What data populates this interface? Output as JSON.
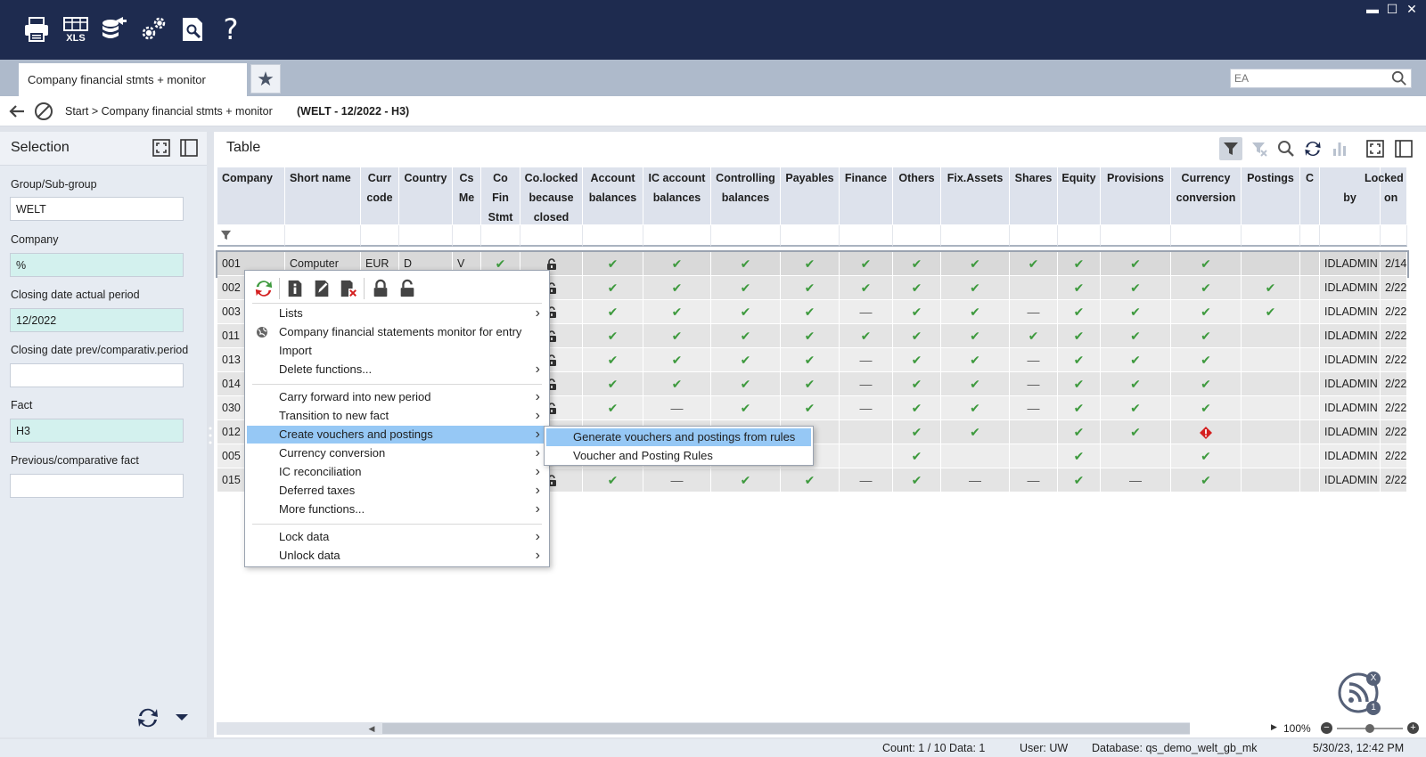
{
  "toolbar": {
    "icons": [
      "printer-icon",
      "xls-export-icon",
      "database-export-icon",
      "settings-icon",
      "document-search-icon",
      "help-icon"
    ],
    "xls_label": "XLS",
    "help_label": "?"
  },
  "window": {
    "minimize": "▬",
    "maximize": "☐",
    "close": "✕"
  },
  "tab": {
    "title": "Company financial stmts + monitor"
  },
  "search": {
    "placeholder": "EA"
  },
  "breadcrumb": {
    "path": "Start > Company financial stmts + monitor",
    "context": "(WELT - 12/2022 - H3)"
  },
  "selection": {
    "title": "Selection",
    "fields": [
      {
        "label": "Group/Sub-group",
        "value": "WELT"
      },
      {
        "label": "Company",
        "value": "%"
      },
      {
        "label": "Closing date actual period",
        "value": "12/2022"
      },
      {
        "label": "Closing date prev/comparativ.period",
        "value": ""
      },
      {
        "label": "Fact",
        "value": "H3"
      },
      {
        "label": "Previous/comparative fact",
        "value": ""
      }
    ]
  },
  "table": {
    "title": "Table",
    "columns": [
      {
        "l1": "Company",
        "l2": "",
        "l3": ""
      },
      {
        "l1": "Short name",
        "l2": "",
        "l3": ""
      },
      {
        "l1": "Curr",
        "l2": "code",
        "l3": ""
      },
      {
        "l1": "Country",
        "l2": "",
        "l3": ""
      },
      {
        "l1": "Cs",
        "l2": "Me",
        "l3": ""
      },
      {
        "l1": "Co",
        "l2": "Fin",
        "l3": "Stmt"
      },
      {
        "l1": "Co.locked",
        "l2": "because",
        "l3": "closed"
      },
      {
        "l1": "Account",
        "l2": "balances",
        "l3": ""
      },
      {
        "l1": "IC account",
        "l2": "balances",
        "l3": ""
      },
      {
        "l1": "Controlling",
        "l2": "balances",
        "l3": ""
      },
      {
        "l1": "Payables",
        "l2": "",
        "l3": ""
      },
      {
        "l1": "Finance",
        "l2": "",
        "l3": ""
      },
      {
        "l1": "Others",
        "l2": "",
        "l3": ""
      },
      {
        "l1": "Fix.Assets",
        "l2": "",
        "l3": ""
      },
      {
        "l1": "Shares",
        "l2": "",
        "l3": ""
      },
      {
        "l1": "Equity",
        "l2": "",
        "l3": ""
      },
      {
        "l1": "Provisions",
        "l2": "",
        "l3": ""
      },
      {
        "l1": "Currency",
        "l2": "conversion",
        "l3": ""
      },
      {
        "l1": "Postings",
        "l2": "",
        "l3": ""
      },
      {
        "l1": "C",
        "l2": "",
        "l3": ""
      },
      {
        "l1": "",
        "l2": "by",
        "l3": ""
      },
      {
        "l1": "Locked",
        "l2": "on",
        "l3": ""
      }
    ],
    "rows": [
      {
        "company": "001",
        "short": "Computer",
        "curr": "EUR",
        "country": "D",
        "csme": "V",
        "cofin": "✔",
        "locked": "lock",
        "cells": [
          "✔",
          "✔",
          "✔",
          "✔",
          "✔",
          "✔",
          "✔",
          "✔",
          "✔",
          "✔",
          "✔",
          ""
        ],
        "by": "IDLADMIN",
        "on": "2/14"
      },
      {
        "company": "002",
        "short": "",
        "curr": "",
        "country": "",
        "csme": "",
        "cofin": "",
        "locked": "lock",
        "cells": [
          "✔",
          "✔",
          "✔",
          "✔",
          "✔",
          "✔",
          "✔",
          "",
          "✔",
          "✔",
          "✔",
          "✔"
        ],
        "by": "IDLADMIN",
        "on": "2/22"
      },
      {
        "company": "003",
        "short": "",
        "curr": "",
        "country": "",
        "csme": "",
        "cofin": "",
        "locked": "lock",
        "cells": [
          "✔",
          "✔",
          "✔",
          "✔",
          "—",
          "✔",
          "✔",
          "—",
          "✔",
          "✔",
          "✔",
          "✔"
        ],
        "by": "IDLADMIN",
        "on": "2/22"
      },
      {
        "company": "011",
        "short": "",
        "curr": "",
        "country": "",
        "csme": "",
        "cofin": "",
        "locked": "lock",
        "cells": [
          "✔",
          "✔",
          "✔",
          "✔",
          "✔",
          "✔",
          "✔",
          "✔",
          "✔",
          "✔",
          "✔",
          ""
        ],
        "by": "IDLADMIN",
        "on": "2/22"
      },
      {
        "company": "013",
        "short": "",
        "curr": "",
        "country": "",
        "csme": "",
        "cofin": "",
        "locked": "lock",
        "cells": [
          "✔",
          "✔",
          "✔",
          "✔",
          "—",
          "✔",
          "✔",
          "—",
          "✔",
          "✔",
          "✔",
          ""
        ],
        "by": "IDLADMIN",
        "on": "2/22"
      },
      {
        "company": "014",
        "short": "",
        "curr": "",
        "country": "",
        "csme": "",
        "cofin": "",
        "locked": "lock",
        "cells": [
          "✔",
          "✔",
          "✔",
          "✔",
          "—",
          "✔",
          "✔",
          "—",
          "✔",
          "✔",
          "✔",
          ""
        ],
        "by": "IDLADMIN",
        "on": "2/22"
      },
      {
        "company": "030",
        "short": "",
        "curr": "",
        "country": "",
        "csme": "",
        "cofin": "",
        "locked": "lock",
        "cells": [
          "✔",
          "—",
          "✔",
          "✔",
          "—",
          "✔",
          "✔",
          "—",
          "✔",
          "✔",
          "✔",
          ""
        ],
        "by": "IDLADMIN",
        "on": "2/22"
      },
      {
        "company": "012",
        "short": "",
        "curr": "",
        "country": "",
        "csme": "",
        "cofin": "",
        "locked": "",
        "cells": [
          "",
          "",
          "",
          "✔",
          "",
          "✔",
          "✔",
          "",
          "✔",
          "✔",
          "!",
          ""
        ],
        "by": "IDLADMIN",
        "on": "2/22"
      },
      {
        "company": "005",
        "short": "",
        "curr": "",
        "country": "",
        "csme": "",
        "cofin": "",
        "locked": "",
        "cells": [
          "",
          "",
          "",
          "",
          "",
          "✔",
          "",
          "",
          "✔",
          "",
          "✔",
          ""
        ],
        "by": "IDLADMIN",
        "on": "2/22"
      },
      {
        "company": "015",
        "short": "",
        "curr": "",
        "country": "",
        "csme": "",
        "cofin": "",
        "locked": "lock",
        "cells": [
          "✔",
          "—",
          "✔",
          "✔",
          "—",
          "✔",
          "—",
          "—",
          "✔",
          "—",
          "✔",
          ""
        ],
        "by": "IDLADMIN",
        "on": "2/22"
      }
    ]
  },
  "context_menu": {
    "tools": [
      "refresh-transfer-icon",
      "info-icon",
      "edit-icon",
      "delete-icon",
      "lock-icon",
      "unlock-icon"
    ],
    "groups": [
      [
        {
          "label": "Lists",
          "sub": true
        },
        {
          "label": "Company financial statements monitor for entry",
          "sub": false,
          "icon": "globe-icon"
        },
        {
          "label": "Import",
          "sub": false
        },
        {
          "label": "Delete functions...",
          "sub": true
        }
      ],
      [
        {
          "label": "Carry forward into new period",
          "sub": true
        },
        {
          "label": "Transition to new fact",
          "sub": true
        },
        {
          "label": "Create vouchers and postings",
          "sub": true,
          "highlight": true
        },
        {
          "label": "Currency conversion",
          "sub": true
        },
        {
          "label": "IC reconciliation",
          "sub": true
        },
        {
          "label": "Deferred taxes",
          "sub": true
        },
        {
          "label": "More functions...",
          "sub": true
        }
      ],
      [
        {
          "label": "Lock data",
          "sub": true
        },
        {
          "label": "Unlock data",
          "sub": true
        }
      ]
    ],
    "submenu": [
      {
        "label": "Generate vouchers and postings from rules",
        "highlight": true
      },
      {
        "label": "Voucher and Posting Rules",
        "highlight": false
      }
    ]
  },
  "zoom": {
    "value": "100%",
    "level": 0.5
  },
  "status": {
    "count": "Count: 1 / 10 Data: 1",
    "user": "User: UW",
    "database": "Database: qs_demo_welt_gb_mk",
    "timestamp": "5/30/23, 12:42 PM"
  },
  "notification": {
    "close": "X",
    "count": "1"
  },
  "colors": {
    "topbar": "#1e2b4f",
    "check": "#3e9a3e",
    "highlight": "#96c8f5",
    "required_field": "#d3f1ee",
    "warning": "#d42020"
  }
}
